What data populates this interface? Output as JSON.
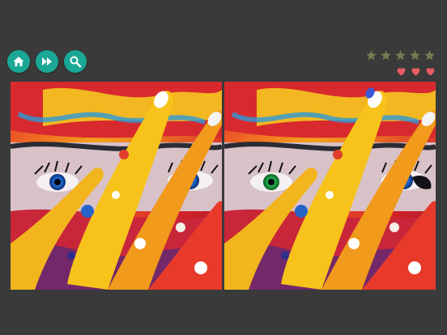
{
  "toolbar": {
    "buttons": [
      {
        "id": "home",
        "icon": "home-icon"
      },
      {
        "id": "skip",
        "icon": "fast-forward-icon"
      },
      {
        "id": "hint",
        "icon": "magnifier-icon"
      }
    ],
    "button_color": "#1aa796"
  },
  "progress": {
    "stars_total": 5,
    "stars_filled": 0,
    "star_color": "#7a7a52",
    "hearts_total": 3,
    "hearts_remaining": 3,
    "heart_color": "#e85c61"
  },
  "puzzle": {
    "left_image": "painted-face-original",
    "right_image": "painted-face-modified",
    "differences_visible": [
      "green-eye",
      "blue-paint-on-finger",
      "dark-mark-right-eye"
    ]
  }
}
